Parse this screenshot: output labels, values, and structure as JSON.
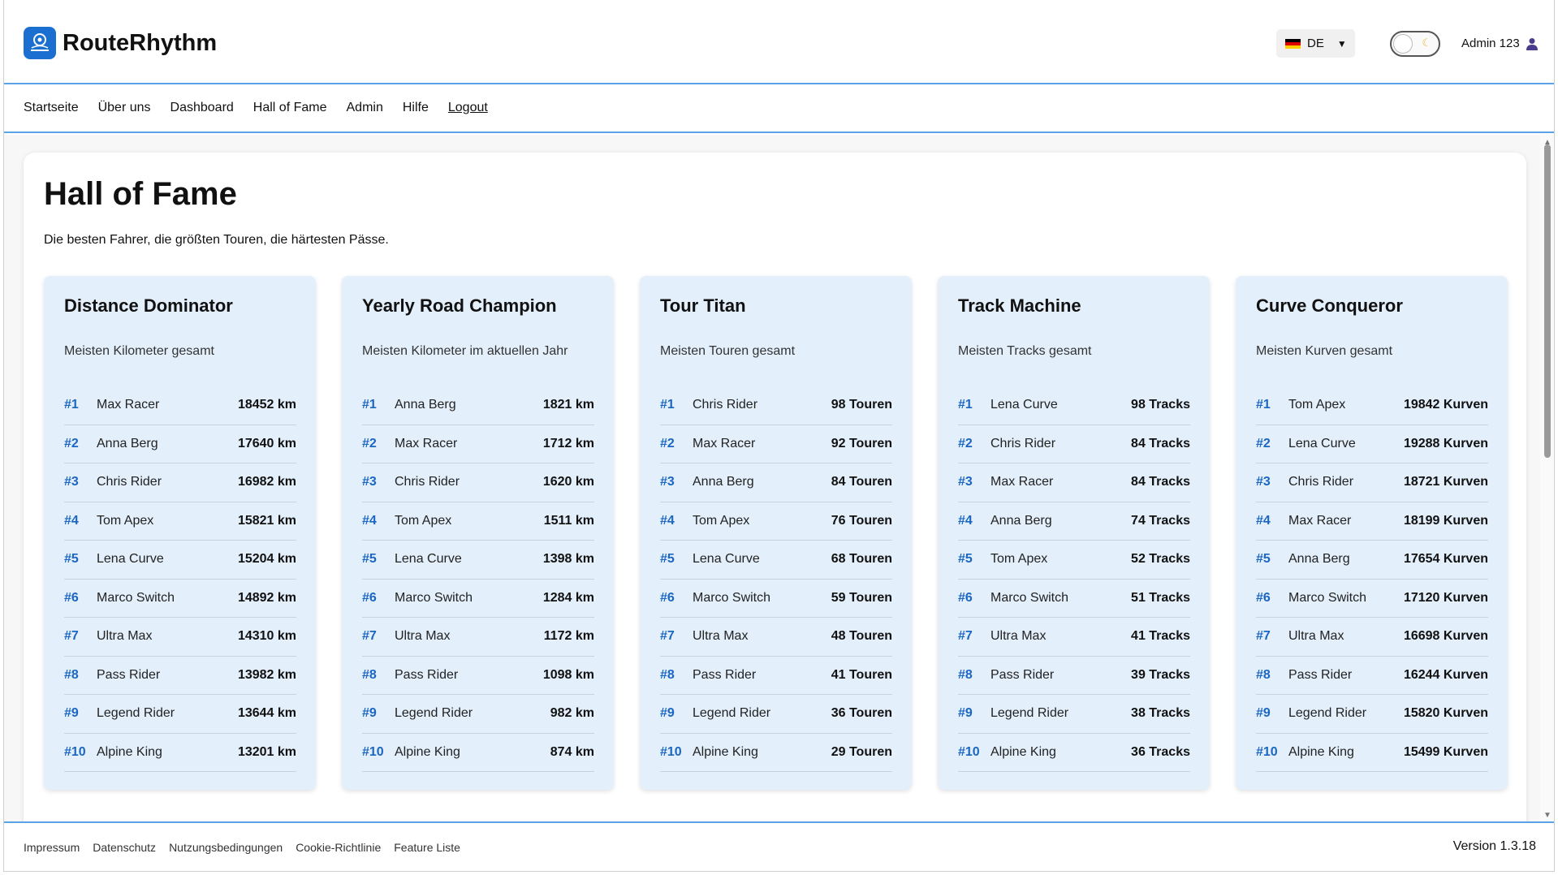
{
  "app": {
    "name": "RouteRhythm",
    "logo_text": "RouteRhythm",
    "language": "DE",
    "user_name": "Admin 123"
  },
  "colors": {
    "accent": "#1a66c2",
    "header_border": "#5aa3e6",
    "card_bg": "#e3effb"
  },
  "nav": {
    "items": [
      "Startseite",
      "Über uns",
      "Dashboard",
      "Hall of Fame",
      "Admin",
      "Hilfe"
    ],
    "logout": "Logout"
  },
  "page": {
    "title": "Hall of Fame",
    "subtitle": "Die besten Fahrer, die größten Touren, die härtesten Pässe."
  },
  "cards": [
    {
      "title": "Distance Dominator",
      "description": "Meisten Kilometer gesamt",
      "rows": [
        {
          "rank": "#1",
          "name": "Max Racer",
          "value": "18452 km"
        },
        {
          "rank": "#2",
          "name": "Anna Berg",
          "value": "17640 km"
        },
        {
          "rank": "#3",
          "name": "Chris Rider",
          "value": "16982 km"
        },
        {
          "rank": "#4",
          "name": "Tom Apex",
          "value": "15821 km"
        },
        {
          "rank": "#5",
          "name": "Lena Curve",
          "value": "15204 km"
        },
        {
          "rank": "#6",
          "name": "Marco Switch",
          "value": "14892 km"
        },
        {
          "rank": "#7",
          "name": "Ultra Max",
          "value": "14310 km"
        },
        {
          "rank": "#8",
          "name": "Pass Rider",
          "value": "13982 km"
        },
        {
          "rank": "#9",
          "name": "Legend Rider",
          "value": "13644 km"
        },
        {
          "rank": "#10",
          "name": "Alpine King",
          "value": "13201 km"
        }
      ]
    },
    {
      "title": "Yearly Road Champion",
      "description": "Meisten Kilometer im aktuellen Jahr",
      "rows": [
        {
          "rank": "#1",
          "name": "Anna Berg",
          "value": "1821 km"
        },
        {
          "rank": "#2",
          "name": "Max Racer",
          "value": "1712 km"
        },
        {
          "rank": "#3",
          "name": "Chris Rider",
          "value": "1620 km"
        },
        {
          "rank": "#4",
          "name": "Tom Apex",
          "value": "1511 km"
        },
        {
          "rank": "#5",
          "name": "Lena Curve",
          "value": "1398 km"
        },
        {
          "rank": "#6",
          "name": "Marco Switch",
          "value": "1284 km"
        },
        {
          "rank": "#7",
          "name": "Ultra Max",
          "value": "1172 km"
        },
        {
          "rank": "#8",
          "name": "Pass Rider",
          "value": "1098 km"
        },
        {
          "rank": "#9",
          "name": "Legend Rider",
          "value": "982 km"
        },
        {
          "rank": "#10",
          "name": "Alpine King",
          "value": "874 km"
        }
      ]
    },
    {
      "title": "Tour Titan",
      "description": "Meisten Touren gesamt",
      "rows": [
        {
          "rank": "#1",
          "name": "Chris Rider",
          "value": "98 Touren"
        },
        {
          "rank": "#2",
          "name": "Max Racer",
          "value": "92 Touren"
        },
        {
          "rank": "#3",
          "name": "Anna Berg",
          "value": "84 Touren"
        },
        {
          "rank": "#4",
          "name": "Tom Apex",
          "value": "76 Touren"
        },
        {
          "rank": "#5",
          "name": "Lena Curve",
          "value": "68 Touren"
        },
        {
          "rank": "#6",
          "name": "Marco Switch",
          "value": "59 Touren"
        },
        {
          "rank": "#7",
          "name": "Ultra Max",
          "value": "48 Touren"
        },
        {
          "rank": "#8",
          "name": "Pass Rider",
          "value": "41 Touren"
        },
        {
          "rank": "#9",
          "name": "Legend Rider",
          "value": "36 Touren"
        },
        {
          "rank": "#10",
          "name": "Alpine King",
          "value": "29 Touren"
        }
      ]
    },
    {
      "title": "Track Machine",
      "description": "Meisten Tracks gesamt",
      "rows": [
        {
          "rank": "#1",
          "name": "Lena Curve",
          "value": "98 Tracks"
        },
        {
          "rank": "#2",
          "name": "Chris Rider",
          "value": "84 Tracks"
        },
        {
          "rank": "#3",
          "name": "Max Racer",
          "value": "84 Tracks"
        },
        {
          "rank": "#4",
          "name": "Anna Berg",
          "value": "74 Tracks"
        },
        {
          "rank": "#5",
          "name": "Tom Apex",
          "value": "52 Tracks"
        },
        {
          "rank": "#6",
          "name": "Marco Switch",
          "value": "51 Tracks"
        },
        {
          "rank": "#7",
          "name": "Ultra Max",
          "value": "41 Tracks"
        },
        {
          "rank": "#8",
          "name": "Pass Rider",
          "value": "39 Tracks"
        },
        {
          "rank": "#9",
          "name": "Legend Rider",
          "value": "38 Tracks"
        },
        {
          "rank": "#10",
          "name": "Alpine King",
          "value": "36 Tracks"
        }
      ]
    },
    {
      "title": "Curve Conqueror",
      "description": "Meisten Kurven gesamt",
      "rows": [
        {
          "rank": "#1",
          "name": "Tom Apex",
          "value": "19842 Kurven"
        },
        {
          "rank": "#2",
          "name": "Lena Curve",
          "value": "19288 Kurven"
        },
        {
          "rank": "#3",
          "name": "Chris Rider",
          "value": "18721 Kurven"
        },
        {
          "rank": "#4",
          "name": "Max Racer",
          "value": "18199 Kurven"
        },
        {
          "rank": "#5",
          "name": "Anna Berg",
          "value": "17654 Kurven"
        },
        {
          "rank": "#6",
          "name": "Marco Switch",
          "value": "17120 Kurven"
        },
        {
          "rank": "#7",
          "name": "Ultra Max",
          "value": "16698 Kurven"
        },
        {
          "rank": "#8",
          "name": "Pass Rider",
          "value": "16244 Kurven"
        },
        {
          "rank": "#9",
          "name": "Legend Rider",
          "value": "15820 Kurven"
        },
        {
          "rank": "#10",
          "name": "Alpine King",
          "value": "15499 Kurven"
        }
      ]
    }
  ],
  "footer": {
    "links": [
      "Impressum",
      "Datenschutz",
      "Nutzungsbedingungen",
      "Cookie-Richtlinie",
      "Feature Liste"
    ],
    "version": "Version 1.3.18"
  }
}
